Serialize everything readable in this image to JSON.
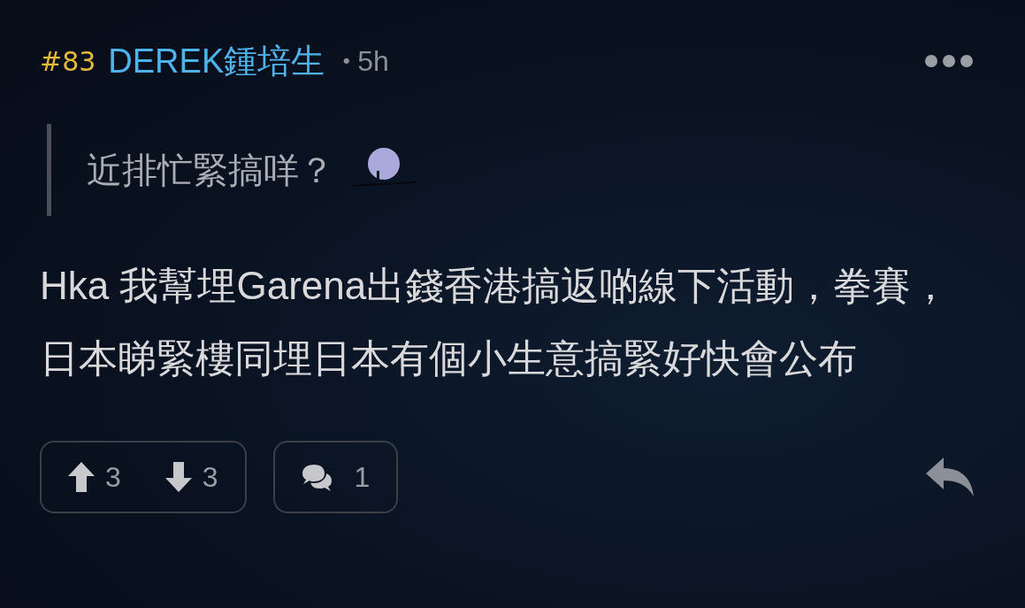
{
  "post": {
    "number": "#83",
    "author": "DEREK鍾培生",
    "separator": "•",
    "time": "5h"
  },
  "quote": {
    "text": "近排忙緊搞咩？"
  },
  "body": "Hka 我幫埋Garena出錢香港搞返啲線下活動，拳賽，日本睇緊樓同埋日本有個小生意搞緊好快會公布",
  "votes": {
    "up": "3",
    "down": "3"
  },
  "replies": {
    "count": "1"
  }
}
